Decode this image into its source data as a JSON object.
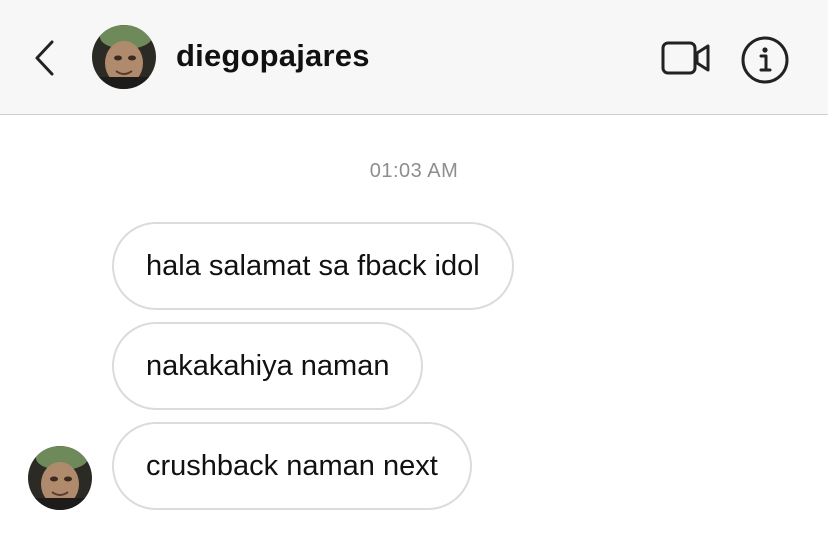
{
  "header": {
    "username": "diegopajares",
    "icons": {
      "back": "chevron-left-icon",
      "video": "video-camera-icon",
      "info": "info-icon"
    }
  },
  "conversation": {
    "timestamp": "01:03 AM",
    "messages": [
      {
        "text": "hala salamat sa fback idol"
      },
      {
        "text": "nakakahiya naman"
      },
      {
        "text": "crushback naman next"
      }
    ]
  },
  "colors": {
    "header_bg": "#f7f7f7",
    "bubble_border": "#dbdbdb",
    "timestamp": "#8e8e8e",
    "text": "#111111"
  }
}
